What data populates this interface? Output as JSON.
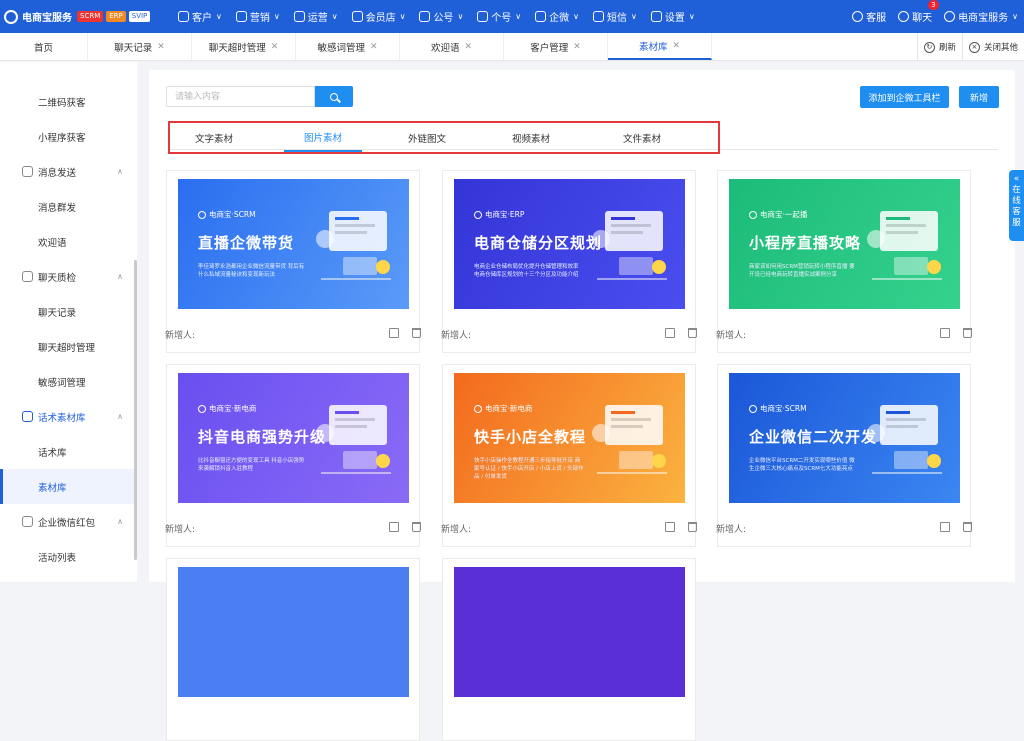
{
  "topbar": {
    "brand": "电商宝服务",
    "badges": [
      "SCRM",
      "ERP",
      "SVIP"
    ],
    "nav": [
      "客户",
      "营销",
      "运营",
      "会员店",
      "公号",
      "个号",
      "企微",
      "短信",
      "设置"
    ],
    "kefu": "客服",
    "chat": "聊天",
    "chat_count": "3",
    "user": "电商宝服务"
  },
  "tabs": [
    "首页",
    "聊天记录",
    "聊天超时管理",
    "敏感词管理",
    "欢迎语",
    "客户管理",
    "素材库"
  ],
  "tab_tools": {
    "refresh": "刷新",
    "close_others": "关闭其他"
  },
  "sidebar": {
    "items": [
      "二维码获客",
      "小程序获客",
      "消息发送",
      "消息群发",
      "欢迎语",
      "聊天质检",
      "聊天记录",
      "聊天超时管理",
      "敏感词管理",
      "话术素材库",
      "话术库",
      "素材库",
      "企业微信红包",
      "活动列表"
    ]
  },
  "search": {
    "placeholder": "请输入内容"
  },
  "buttons": {
    "add_toolbar": "添加到企微工具栏",
    "new": "新增"
  },
  "content_tabs": [
    "文字素材",
    "图片素材",
    "外链图文",
    "视频素材",
    "文件素材"
  ],
  "float_tab": "在线客服",
  "cards": [
    {
      "brand": "电商宝·SCRM",
      "title": "直播企微带货",
      "sub": "李佳琦罗永浩都用企业微信流量带货 背后有什么私域流量秘诀和变现新玩法",
      "meta": "新增人:",
      "color1": "#2a6ef0",
      "color2": "#5a9bf8"
    },
    {
      "brand": "电商宝·ERP",
      "title": "电商仓储分区规划",
      "sub": "电商企业仓储布局优化提升仓储管理和效率 电商仓储库区规划的十三个分区及功能介绍",
      "meta": "新增人:",
      "color1": "#3435d6",
      "color2": "#4a4ef0"
    },
    {
      "brand": "电商宝·一起播",
      "title": "小程序直播攻略",
      "sub": "商家该如何用SCRM营销玩转小程序直播 要开设已经电商玩转直播实战案例分享",
      "meta": "新增人:",
      "color1": "#1dbb79",
      "color2": "#35d28e"
    },
    {
      "brand": "电商宝·新电商",
      "title": "抖音电商强势升级",
      "sub": "比抖音橱窗还方便的变现工具 抖音小店强势来袭解锁抖音入驻教程",
      "meta": "新增人:",
      "color1": "#6a4ff0",
      "color2": "#8a6bf7"
    },
    {
      "brand": "电商宝·新电商",
      "title": "快手小店全教程",
      "sub": "快手小店操作全教程开通三步指导批开店 商家号认证 / 快手小店开店 / 小店上货 / 头部作品 / 付单发货",
      "meta": "新增人:",
      "color1": "#f36a1e",
      "color2": "#fbb340"
    },
    {
      "brand": "电商宝·SCRM",
      "title": "企业微信二次开发",
      "sub": "企业微信平台SCRM二开发实现哪些价值 微生企微三大核心痛点及SCRM七大功能亮点",
      "meta": "新增人:",
      "color1": "#1b57d8",
      "color2": "#3b87f2"
    }
  ],
  "colors": {
    "primary": "#1f5fd8",
    "accent": "#1f8ef1",
    "highlight_border": "#e4393c"
  }
}
